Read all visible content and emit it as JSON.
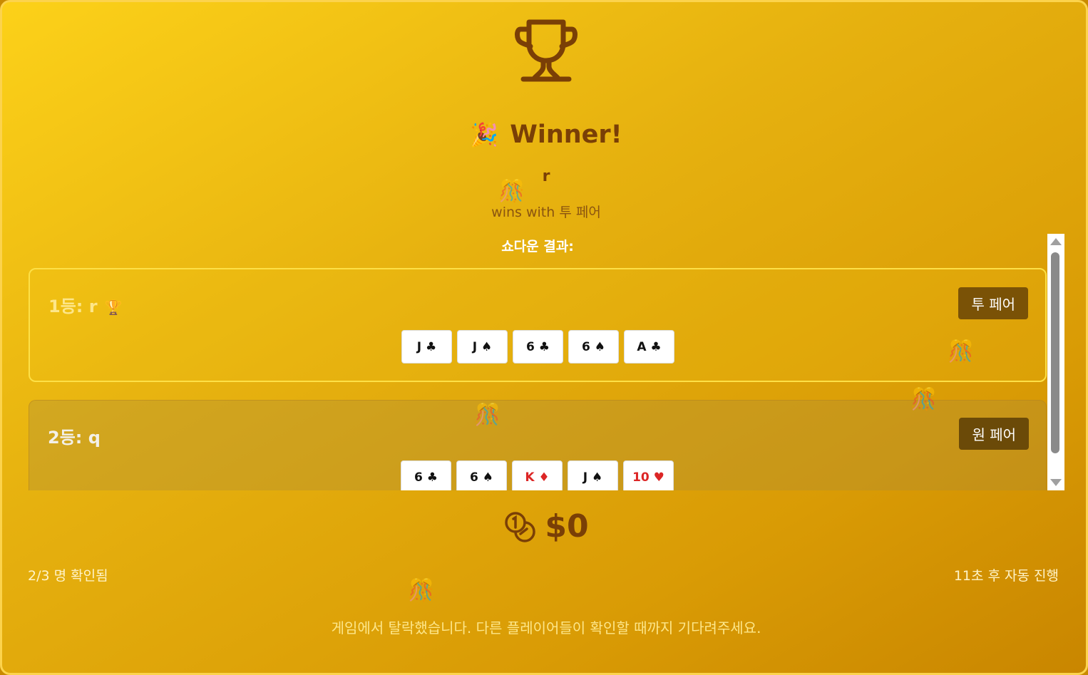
{
  "header": {
    "title": "Winner!",
    "party_emoji": "🎉",
    "winner_name": "r",
    "wins_with": "wins with 투 페어"
  },
  "showdown": {
    "label": "쇼다운 결과:",
    "results": [
      {
        "rank_label": "1등: r",
        "medal": "🏆",
        "hand": "투 페어",
        "cards": [
          "J ♣",
          "J ♠",
          "6 ♣",
          "6 ♠",
          "A ♣"
        ]
      },
      {
        "rank_label": "2등: q",
        "hand": "원 페어",
        "cards": [
          "6 ♣",
          "6 ♠",
          "K ♦",
          "J ♠",
          "10 ♥"
        ]
      }
    ]
  },
  "pot": {
    "amount": "$0",
    "icon": "coins-icon"
  },
  "footer": {
    "confirmed": "2/3 명 확인됨",
    "auto_advance": "11초 후 자동 진행",
    "eliminated_message": "게임에서 탈락했습니다. 다른 플레이어들이 확인할 때까지 기다려주세요."
  },
  "colors": {
    "accent": "#7a3f06",
    "background_start": "#fcd119",
    "background_end": "#c98600",
    "card_red": "#dc2626"
  }
}
